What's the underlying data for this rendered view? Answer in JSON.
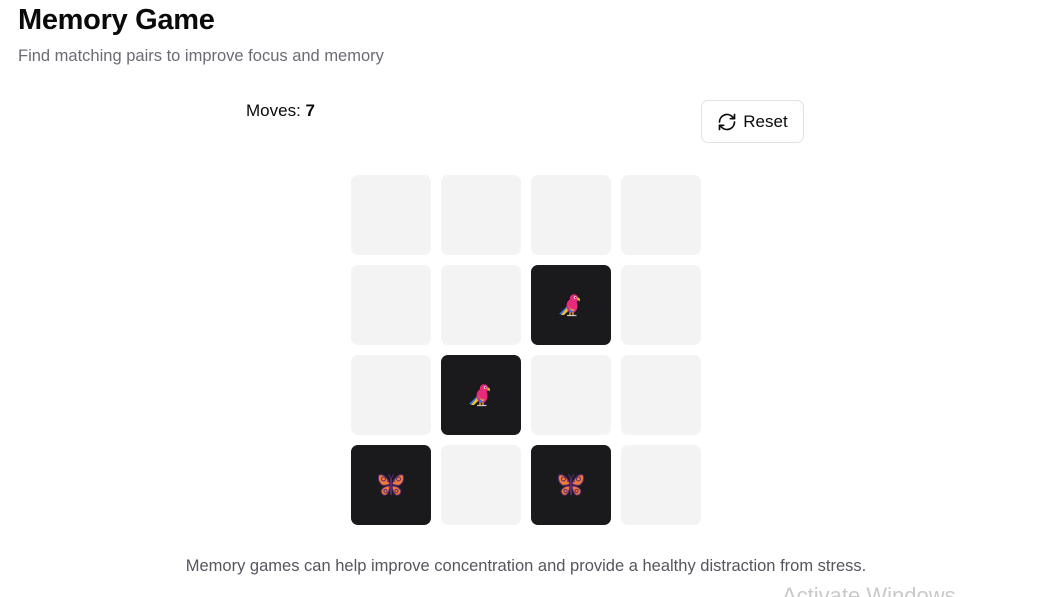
{
  "header": {
    "title": "Memory Game",
    "subtitle": "Find matching pairs to improve focus and memory"
  },
  "status": {
    "moves_label": "Moves:",
    "moves_value": "7"
  },
  "toolbar": {
    "reset_label": "Reset",
    "reset_icon": "refresh-icon"
  },
  "board": {
    "rows": 4,
    "cols": 4,
    "cards": [
      {
        "state": "hidden",
        "icon": ""
      },
      {
        "state": "hidden",
        "icon": ""
      },
      {
        "state": "hidden",
        "icon": ""
      },
      {
        "state": "hidden",
        "icon": ""
      },
      {
        "state": "hidden",
        "icon": ""
      },
      {
        "state": "hidden",
        "icon": ""
      },
      {
        "state": "flipped",
        "icon": "parrot-icon"
      },
      {
        "state": "hidden",
        "icon": ""
      },
      {
        "state": "hidden",
        "icon": ""
      },
      {
        "state": "flipped",
        "icon": "parrot-icon"
      },
      {
        "state": "hidden",
        "icon": ""
      },
      {
        "state": "hidden",
        "icon": ""
      },
      {
        "state": "flipped",
        "icon": "butterfly-icon"
      },
      {
        "state": "hidden",
        "icon": ""
      },
      {
        "state": "flipped",
        "icon": "butterfly-icon"
      },
      {
        "state": "hidden",
        "icon": ""
      }
    ],
    "colors": {
      "hidden": "#f3f3f3",
      "flipped": "#1a1a1d"
    }
  },
  "footer": {
    "text": "Memory games can help improve concentration and provide a healthy distraction from stress."
  },
  "overlay": {
    "watermark": "Activate Windows"
  }
}
